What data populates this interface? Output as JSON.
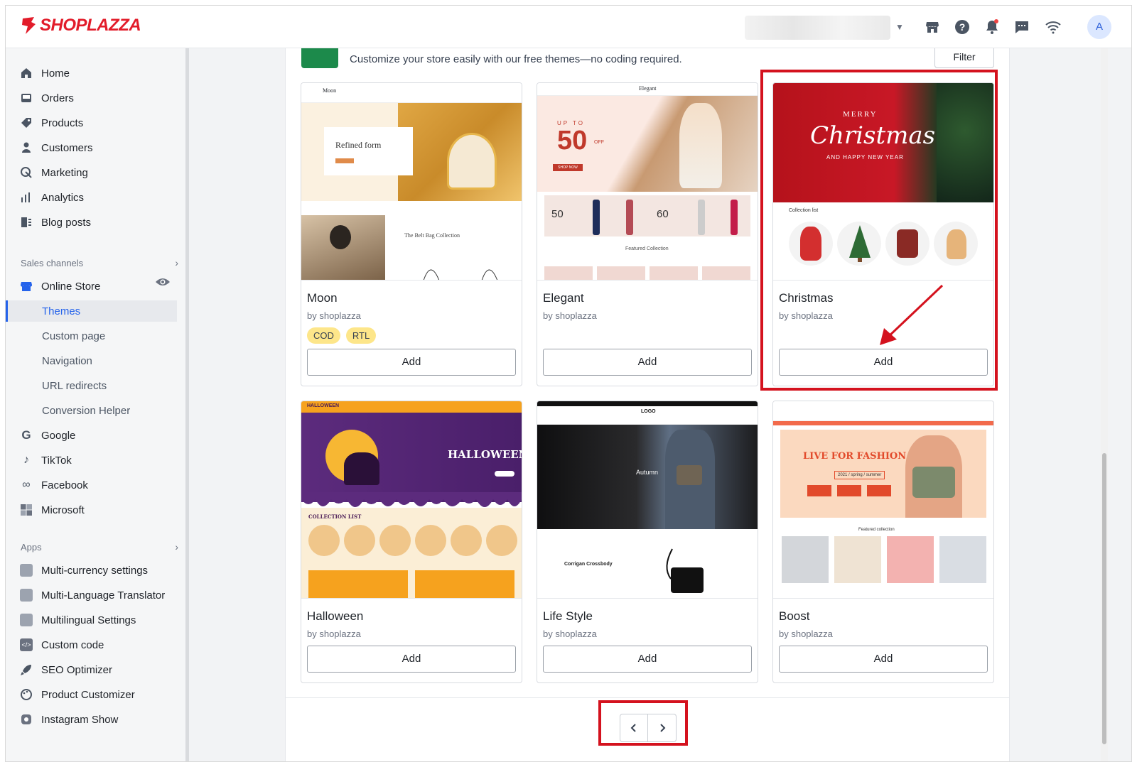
{
  "app": {
    "logo_text": "SHOPLAZZA",
    "avatar_initial": "A"
  },
  "sidebar": {
    "items": [
      {
        "label": "Home",
        "icon": "home-icon"
      },
      {
        "label": "Orders",
        "icon": "orders-icon"
      },
      {
        "label": "Products",
        "icon": "tag-icon"
      },
      {
        "label": "Customers",
        "icon": "person-icon"
      },
      {
        "label": "Marketing",
        "icon": "marketing-icon"
      },
      {
        "label": "Analytics",
        "icon": "bar-chart-icon"
      },
      {
        "label": "Blog posts",
        "icon": "blog-icon"
      }
    ],
    "sales_channels_label": "Sales channels",
    "online_store_label": "Online Store",
    "online_store_sub": [
      "Themes",
      "Custom page",
      "Navigation",
      "URL redirects",
      "Conversion Helper"
    ],
    "channels": [
      {
        "label": "Google",
        "icon": "google-icon"
      },
      {
        "label": "TikTok",
        "icon": "tiktok-icon"
      },
      {
        "label": "Facebook",
        "icon": "meta-icon"
      },
      {
        "label": "Microsoft",
        "icon": "microsoft-icon"
      }
    ],
    "apps_label": "Apps",
    "apps": [
      {
        "label": "Multi-currency settings"
      },
      {
        "label": "Multi-Language Translator"
      },
      {
        "label": "Multilingual Settings"
      },
      {
        "label": "Custom code"
      },
      {
        "label": "SEO Optimizer"
      },
      {
        "label": "Product Customizer"
      },
      {
        "label": "Instagram Show"
      }
    ]
  },
  "main": {
    "intro": "Customize your store easily with our free themes—no coding required.",
    "filter_label": "Filter",
    "themes": [
      {
        "name": "Moon",
        "by": "by shoplazza",
        "tags": [
          "COD",
          "RTL"
        ],
        "add": "Add"
      },
      {
        "name": "Elegant",
        "by": "by shoplazza",
        "tags": [],
        "add": "Add"
      },
      {
        "name": "Christmas",
        "by": "by shoplazza",
        "tags": [],
        "add": "Add"
      },
      {
        "name": "Halloween",
        "by": "by shoplazza",
        "tags": [],
        "add": "Add"
      },
      {
        "name": "Life Style",
        "by": "by shoplazza",
        "tags": [],
        "add": "Add"
      },
      {
        "name": "Boost",
        "by": "by shoplazza",
        "tags": [],
        "add": "Add"
      }
    ],
    "thumbs": {
      "moon": {
        "brand": "Moon",
        "hero": "Refined form",
        "sub": "The Belt Bag Collection"
      },
      "elegant": {
        "brand": "Elegant",
        "promo1": "50",
        "promo2": "50",
        "promo3": "60",
        "featured": "Featured Collection",
        "shop_now": "SHOP NOW",
        "up_to": "UP TO",
        "off": "OFF"
      },
      "christmas": {
        "line1": "MERRY",
        "line2": "Christmas",
        "line3": "AND HAPPY NEW YEAR",
        "collection": "Collection list"
      },
      "halloween": {
        "title": "HALLOWEEN",
        "collection": "COLLECTION LIST"
      },
      "lifestyle": {
        "logo": "LOGO",
        "hero": "Autumn",
        "product": "Corrigan Crossbody"
      },
      "boost": {
        "headline": "LIVE FOR FASHION",
        "season": "2021 / spring / summer",
        "featured": "Featured collection"
      }
    }
  },
  "colors": {
    "brand_red": "#e21c2a",
    "highlight": "#d4121e",
    "active_blue": "#2563eb",
    "tag_yellow": "#fde68a"
  }
}
